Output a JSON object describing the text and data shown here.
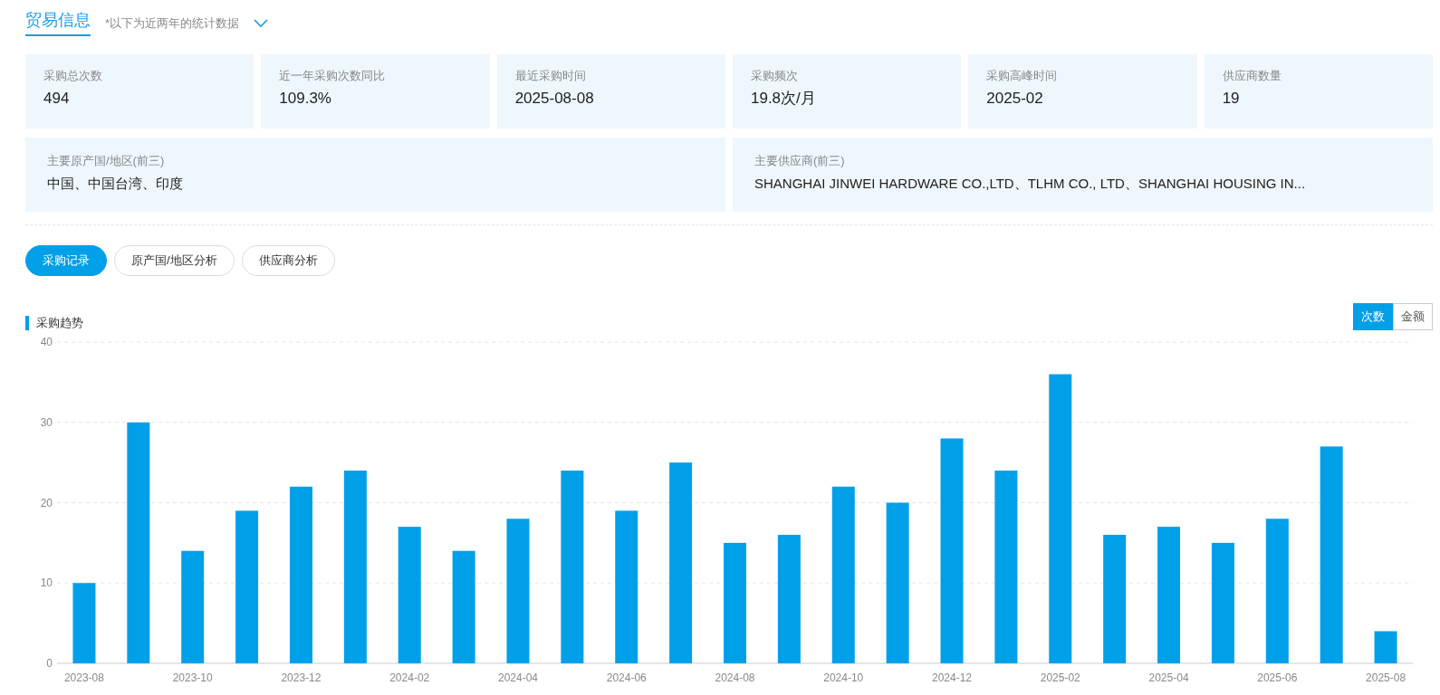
{
  "header": {
    "title": "贸易信息",
    "subtitle": "*以下为近两年的统计数据"
  },
  "stats": [
    {
      "label": "采购总次数",
      "value": "494"
    },
    {
      "label": "近一年采购次数同比",
      "value": "109.3%"
    },
    {
      "label": "最近采购时间",
      "value": "2025-08-08"
    },
    {
      "label": "采购频次",
      "value": "19.8次/月"
    },
    {
      "label": "采购高峰时间",
      "value": "2025-02"
    },
    {
      "label": "供应商数量",
      "value": "19"
    }
  ],
  "top_lists": [
    {
      "label": "主要原产国/地区(前三)",
      "value": "中国、中国台湾、印度"
    },
    {
      "label": "主要供应商(前三)",
      "value": "SHANGHAI JINWEI HARDWARE CO.,LTD、TLHM CO., LTD、SHANGHAI HOUSING IN..."
    }
  ],
  "tabs": [
    {
      "label": "采购记录",
      "selected": true
    },
    {
      "label": "原产国/地区分析",
      "selected": false
    },
    {
      "label": "供应商分析",
      "selected": false
    }
  ],
  "trend": {
    "title": "采购趋势",
    "toggles": [
      {
        "label": "次数",
        "selected": true
      },
      {
        "label": "金额",
        "selected": false
      }
    ],
    "chart_data": {
      "type": "bar",
      "categories": [
        "2023-08",
        null,
        "2023-10",
        null,
        "2023-12",
        null,
        "2024-02",
        null,
        "2024-04",
        null,
        "2024-06",
        null,
        "2024-08",
        null,
        "2024-10",
        null,
        "2024-12",
        null,
        "2025-02",
        null,
        "2025-04",
        null,
        "2025-06",
        null,
        "2025-08"
      ],
      "grid": true,
      "series": [
        {
          "color": "#00a0e9",
          "values": [
            10,
            30,
            14,
            19,
            22,
            24,
            17,
            14,
            18,
            24,
            19,
            25,
            15,
            16,
            22,
            20,
            28,
            24,
            36,
            16,
            17,
            15,
            18,
            27,
            4
          ]
        }
      ],
      "ylim": [
        0,
        40
      ],
      "yticks": [
        0,
        10,
        20,
        30,
        40
      ]
    }
  }
}
